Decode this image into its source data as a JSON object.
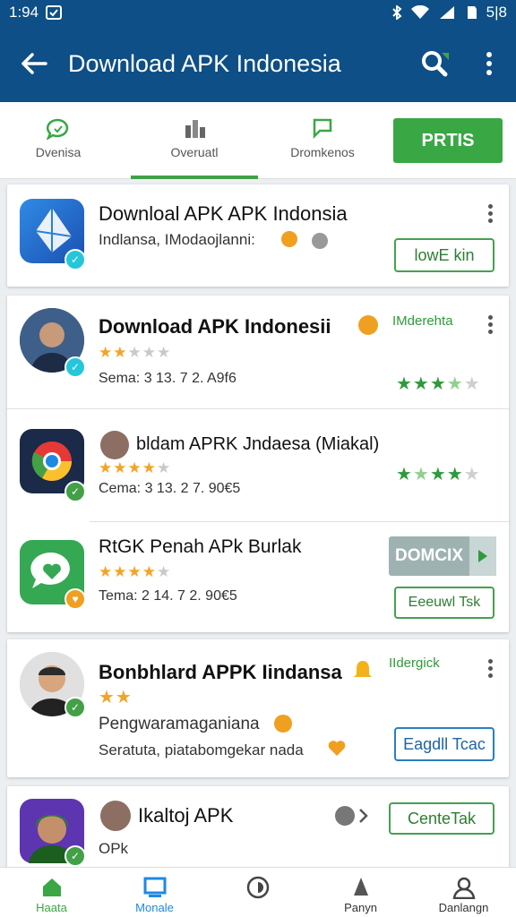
{
  "status": {
    "time": "1:94",
    "battery": "5|8"
  },
  "appbar": {
    "title": "Download APK Indonesia"
  },
  "tabs": [
    {
      "label": "Dvenisa",
      "icon": "chat-bubble-icon"
    },
    {
      "label": "Overuatl",
      "icon": "bars-icon"
    },
    {
      "label": "Dromkenos",
      "icon": "flag-icon"
    }
  ],
  "tab_button": "PRTIS",
  "cards": {
    "c1": {
      "title": "Downloal APK APK Indonsia",
      "subtitle": "Indlansa, IModaojlanni:",
      "button": "lowE kin"
    },
    "c2r1": {
      "title": "Download APK Indonesii",
      "tag": "IMderehta",
      "meta": "Sema: 3 13. 7 2. A9f6"
    },
    "c2r2": {
      "title": "bldam APRK Jndaesa (Miakal)",
      "meta": "Cema: 3 13. 2 7. 90€5"
    },
    "c2r3": {
      "title": "RtGK Penah APk Burlak",
      "meta": "Tema: 2 14. 7 2. 90€5",
      "button1": "DOMCIX",
      "button2": "Eeeuwl Tsk"
    },
    "c3": {
      "title": "Bonbhlard APPK Iindansa",
      "tag": "IIdergick",
      "line1": "Pengwaramaganiana",
      "line2": "Seratuta, piatabomgekar nada",
      "button": "Eagdll Tcac"
    },
    "c4": {
      "title": "Ikaltoj APK",
      "line1": "OPk",
      "button": "CenteTak"
    }
  },
  "bottom_nav": [
    {
      "label": "Haata",
      "icon": "home-icon"
    },
    {
      "label": "Monale",
      "icon": "monitor-icon"
    },
    {
      "label": "",
      "icon": "coin-icon"
    },
    {
      "label": "Panyn",
      "icon": "person-icon"
    },
    {
      "label": "Danlangn",
      "icon": "profile-icon"
    }
  ],
  "colors": {
    "appbar": "#0d4f86",
    "accent": "#3aa745",
    "star": "#f3a326"
  }
}
